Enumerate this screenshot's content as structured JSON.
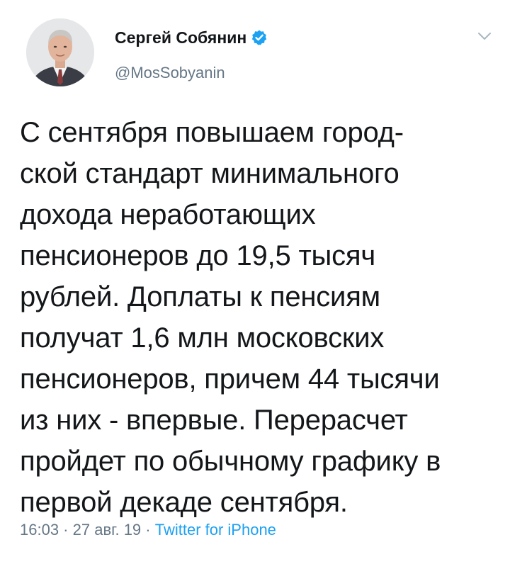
{
  "author": {
    "display_name": "Сергей Собянин",
    "handle": "@MosSobyanin",
    "verified": true,
    "avatar_icon": "profile-photo"
  },
  "menu": {
    "icon": "chevron-down-icon"
  },
  "tweet": {
    "lines": [
      "С сентября повышаем город-",
      "ской стандарт минимального",
      "дохода неработающих",
      "пенсионеров до 19,5 тысяч",
      "рублей. Доплаты к пенсиям",
      "получат 1,6 млн московских",
      "пенсионеров, причем 44 тысячи",
      "из них - впервые. Перерасчет",
      "пройдет по обычному графику в",
      "первой декаде сентября."
    ]
  },
  "meta": {
    "time": "16:03",
    "separator": " · ",
    "date": "27 авг. 19",
    "source": "Twitter for iPhone"
  },
  "colors": {
    "text": "#14171a",
    "secondary": "#657786",
    "link": "#1da1f2",
    "verified_badge": "#1da1f2"
  }
}
